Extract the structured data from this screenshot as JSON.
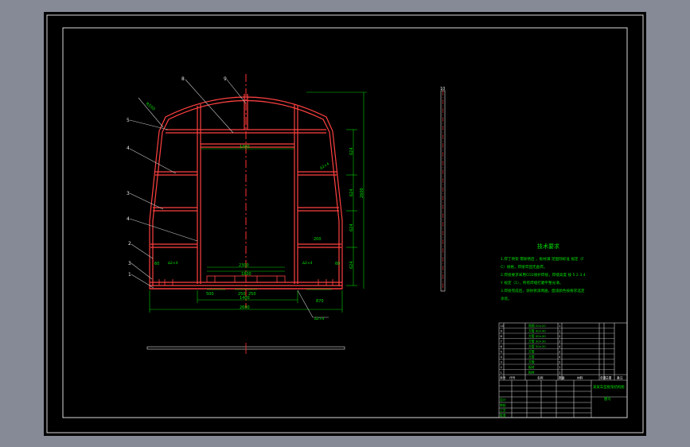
{
  "drawing": {
    "title": "",
    "callouts": [
      "8",
      "9",
      "5",
      "4",
      "3",
      "4",
      "2",
      "3",
      "1",
      "10"
    ],
    "dims_width": [
      "1400",
      "2300",
      "1800",
      "1400",
      "500",
      "250",
      "250",
      "870",
      "2600"
    ],
    "dims_height": [
      "624",
      "624",
      "624",
      "624",
      "2600"
    ],
    "small_labels": [
      "R550",
      "200",
      "60",
      "60"
    ],
    "weld_symbols": [
      "∆2×4",
      "∆2×4",
      "∆2×4",
      "∆2×4"
    ]
  },
  "tech_requirements": {
    "heading": "技术要求",
    "lines": [
      "1.焊丁骨架 需除锈后 ，板材满 足国际标准 规定（F",
      "C）规格，焊接牢固无虚焊。",
      "2.焊接要求采用CO2保护焊接，焊缝高度 按 5 2 3 4",
      "Y 规定（1），所有焊缝打磨平整光滑。",
      "3.焊接完成后，涂防锈漆两遍，面漆颜色按要求选定",
      "涂装。"
    ]
  },
  "title_block": {
    "drawing_title": "某某车型框架结构图",
    "material": "",
    "sheet": "图号",
    "header_cols": [
      "序号",
      "代号",
      "名称",
      "数量",
      "材料",
      "单重",
      "总重",
      "备注"
    ],
    "parts": [
      {
        "no": "10",
        "name": "角钢 20×20",
        "qty": "1"
      },
      {
        "no": "9",
        "name": "方管 40×40",
        "qty": "1"
      },
      {
        "no": "8",
        "name": "方管 40×40",
        "qty": "2"
      },
      {
        "no": "7",
        "name": "方管 30×30",
        "qty": "2"
      },
      {
        "no": "6",
        "name": "方管 30×30",
        "qty": "4"
      },
      {
        "no": "5",
        "name": "方管",
        "qty": "2"
      },
      {
        "no": "4",
        "name": "方管",
        "qty": "4"
      },
      {
        "no": "3",
        "name": "方管",
        "qty": "2"
      },
      {
        "no": "2",
        "name": "板材",
        "qty": "1"
      },
      {
        "no": "1",
        "name": "板材",
        "qty": "1"
      }
    ],
    "sign_rows": [
      "设计",
      "审核",
      "工艺",
      "批准"
    ]
  }
}
